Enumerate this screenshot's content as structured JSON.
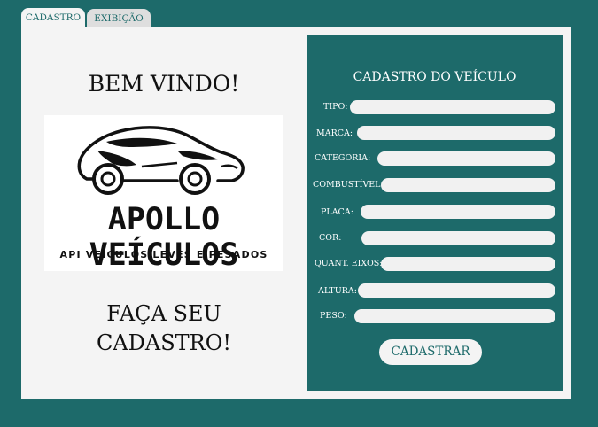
{
  "tabs": [
    {
      "label": "CADASTRO"
    },
    {
      "label": "EXIBIÇÃO"
    }
  ],
  "left": {
    "welcome": "BEM VINDO!",
    "logo_title": "APOLLO VEÍCULOS",
    "logo_subtitle": "API VEÍCULOS LEVES E PESADOS",
    "cta_line1": "FAÇA SEU",
    "cta_line2": "CADASTRO!"
  },
  "form": {
    "title": "CADASTRO DO VEÍCULO",
    "fields": [
      {
        "label": "TIPO:",
        "value": ""
      },
      {
        "label": "MARCA:",
        "value": ""
      },
      {
        "label": "CATEGORIA:",
        "value": ""
      },
      {
        "label": "COMBUSTÍVEL:",
        "value": ""
      },
      {
        "label": "PLACA:",
        "value": ""
      },
      {
        "label": "COR:",
        "value": ""
      },
      {
        "label": "QUANT. EIXOS:",
        "value": ""
      },
      {
        "label": "ALTURA:",
        "value": ""
      },
      {
        "label": "PESO:",
        "value": ""
      }
    ],
    "submit_label": "CADASTRAR"
  },
  "colors": {
    "background": "#1d6a6a",
    "panel": "#f4f4f4",
    "accent": "#1d6a6a"
  }
}
